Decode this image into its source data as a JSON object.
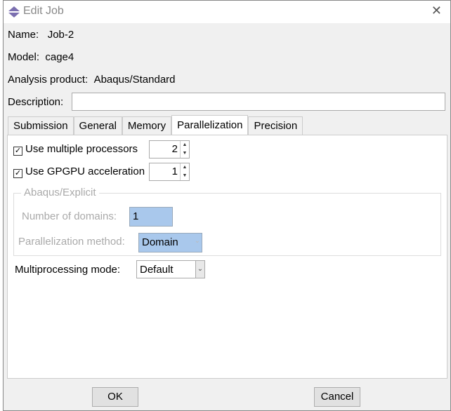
{
  "window": {
    "title": "Edit Job",
    "close_icon": "close-icon"
  },
  "info": {
    "name_label": "Name:",
    "name_value": "Job-2",
    "model_label": "Model:",
    "model_value": "cage4",
    "product_label": "Analysis product:",
    "product_value": "Abaqus/Standard",
    "description_label": "Description:",
    "description_value": ""
  },
  "tabs": [
    {
      "label": "Submission"
    },
    {
      "label": "General"
    },
    {
      "label": "Memory"
    },
    {
      "label": "Parallelization",
      "active": true
    },
    {
      "label": "Precision"
    }
  ],
  "parallel": {
    "multi_proc_label": "Use multiple processors",
    "multi_proc_checked": true,
    "multi_proc_value": "2",
    "gpgpu_label": "Use GPGPU acceleration",
    "gpgpu_checked": true,
    "gpgpu_value": "1",
    "explicit_group": "Abaqus/Explicit",
    "domains_label": "Number of domains:",
    "domains_value": "1",
    "method_label": "Parallelization method:",
    "method_value": "Domain",
    "mode_label": "Multiprocessing mode:",
    "mode_value": "Default"
  },
  "buttons": {
    "ok": "OK",
    "cancel": "Cancel"
  }
}
